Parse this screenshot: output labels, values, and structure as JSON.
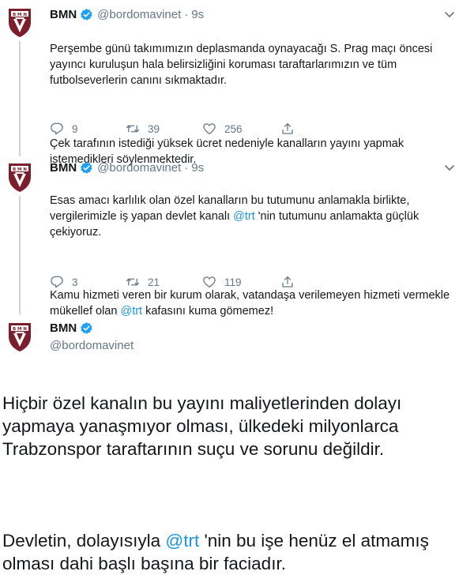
{
  "account": {
    "name": "BMN",
    "handle": "@bordomavinet",
    "avatar_icon": "club-crest-icon",
    "verified_icon": "verified-badge-icon",
    "separator": "·"
  },
  "colors": {
    "mention": "#1b95e0",
    "muted": "#657786",
    "verified": "#1da1f2",
    "crest": "#7a1f2b"
  },
  "tweets": [
    {
      "time": "9s",
      "p1": "Perşembe günü takımımızın deplasmanda oynayacağı S. Prag maçı öncesi yayıncı kuruluşun hala belirsizliğini koruması taraftarlarımızın ve tüm futbolseverlerin canını sıkmaktadır.",
      "p2": "Çek tarafının istediği yüksek ücret nedeniyle kanalların yayını yapmak istemedikleri söylenmektedir.",
      "replies": "9",
      "retweets": "39",
      "likes": "256"
    },
    {
      "time": "9s",
      "p1_a": "Esas amacı karlılık olan özel kanalların bu tutumunu anlamakla birlikte, vergilerimizle iş yapan devlet kanalı ",
      "mention": "@trt",
      "p1_b": " 'nin tutumunu anlamakta güçlük çekiyoruz.",
      "p2_a": "Kamu hizmeti veren bir kurum olarak, vatandaşa verilemeyen hizmeti vermekle mükellef olan ",
      "p2_b": " kafasını kuma gömemez!",
      "replies": "3",
      "retweets": "21",
      "likes": "119"
    }
  ],
  "main_tweet": {
    "p1": "Hiçbir özel kanalın bu yayını maliyetlerinden dolayı yapmaya yanaşmıyor olması, ülkedeki milyonlarca Trabzonspor taraftarının suçu ve sorunu değildir.",
    "p2_a": "Devletin, dolayısıyla ",
    "mention": "@trt",
    "p2_b": " 'nin bu işe henüz el atmamış olması dahi başlı başına bir faciadır."
  }
}
